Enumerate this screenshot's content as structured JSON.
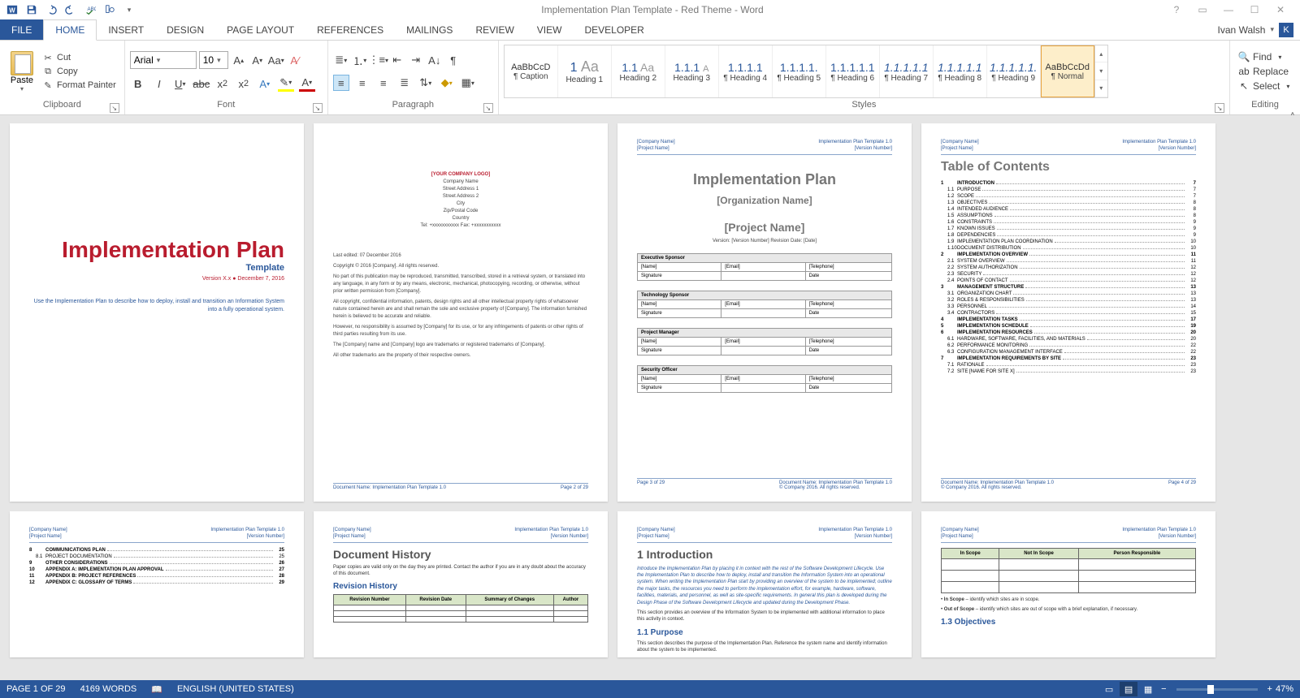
{
  "app": {
    "title": "Implementation Plan Template - Red Theme - Word",
    "user": "Ivan Walsh",
    "user_initial": "K"
  },
  "qat": {
    "save": "Save",
    "undo": "Undo",
    "redo": "Redo",
    "spell": "Spelling",
    "touch": "Touch/Mouse Mode"
  },
  "tabs": {
    "file": "FILE",
    "home": "HOME",
    "insert": "INSERT",
    "design": "DESIGN",
    "page_layout": "PAGE LAYOUT",
    "references": "REFERENCES",
    "mailings": "MAILINGS",
    "review": "REVIEW",
    "view": "VIEW",
    "developer": "DEVELOPER"
  },
  "ribbon": {
    "clipboard": {
      "label": "Clipboard",
      "paste": "Paste",
      "cut": "Cut",
      "copy": "Copy",
      "painter": "Format Painter"
    },
    "font": {
      "label": "Font",
      "name": "Arial",
      "size": "10"
    },
    "paragraph": {
      "label": "Paragraph"
    },
    "styles": {
      "label": "Styles",
      "items": [
        {
          "preview": "AaBbCcD",
          "name": "¶ Caption"
        },
        {
          "preview": "1",
          "name": "Heading 1"
        },
        {
          "preview": "1.1",
          "name": "Heading 2"
        },
        {
          "preview": "1.1.1",
          "name": "Heading 3"
        },
        {
          "preview": "1.1.1.1",
          "name": "¶ Heading 4"
        },
        {
          "preview": "1.1.1.1.",
          "name": "¶ Heading 5"
        },
        {
          "preview": "1.1.1.1.1",
          "name": "¶ Heading 6"
        },
        {
          "preview": "1.1.1.1.1",
          "name": "¶ Heading 7"
        },
        {
          "preview": "1.1.1.1.1",
          "name": "¶ Heading 8"
        },
        {
          "preview": "1.1.1.1.1.",
          "name": "¶ Heading 9"
        },
        {
          "preview": "AaBbCcDd",
          "name": "¶ Normal"
        }
      ],
      "preview_aa": "Aa"
    },
    "editing": {
      "label": "Editing",
      "find": "Find",
      "replace": "Replace",
      "select": "Select"
    }
  },
  "doc": {
    "header_left1": "[Company Name]",
    "header_left2": "[Project Name]",
    "header_right1": "Implementation Plan Template 1.0",
    "header_right2": "[Version Number]",
    "footer_doc": "Document Name: Implementation Plan Template 1.0",
    "footer_copy": "© Company 2016. All rights reserved.",
    "page1": {
      "title": "Implementation Plan",
      "subtitle": "Template",
      "version": "Version X.x ● December 7, 2016",
      "desc": "Use the Implementation Plan to describe how to deploy, install and transition an Information System into a fully operational system."
    },
    "page2": {
      "logo": "[YOUR COMPANY LOGO]",
      "lines": [
        "Company Name",
        "Street Address 1",
        "Street Address 2",
        "City",
        "Zip/Postal Code",
        "Country",
        "Tel: +xxxxxxxxxxx  Fax: +xxxxxxxxxxx"
      ],
      "edited": "Last edited: 07 December 2016",
      "copyright": "Copyright © 2016 [Company]. All rights reserved.",
      "body": [
        "No part of this publication may be reproduced, transmitted, transcribed, stored in a retrieval system, or translated into any language, in any form or by any means, electronic, mechanical, photocopying, recording, or otherwise, without prior written permission from [Company].",
        "All copyright, confidential information, patents, design rights and all other intellectual property rights of whatsoever nature contained herein are and shall remain the sole and exclusive property of [Company]. The information furnished herein is believed to be accurate and reliable.",
        "However, no responsibility is assumed by [Company] for its use, or for any infringements of patents or other rights of third parties resulting from its use.",
        "The [Company] name and [Company] logo are trademarks or registered trademarks of [Company].",
        "All other trademarks are the property of their respective owners."
      ],
      "pgno": "Page 2 of 29"
    },
    "page3": {
      "h1": "Implementation Plan",
      "h2": "[Organization Name]",
      "h3": "[Project Name]",
      "meta": "Version: [Version Number]          Revision Date: [Date]",
      "roles": [
        "Executive Sponsor",
        "Technology Sponsor",
        "Project Manager",
        "Security Officer"
      ],
      "cols": [
        "[Name]",
        "[Email]",
        "[Telephone]"
      ],
      "sig": "Signature",
      "date": "Date",
      "pgno": "Page 3 of 29"
    },
    "page4": {
      "title": "Table of Contents",
      "toc": [
        {
          "n": "1",
          "t": "INTRODUCTION",
          "p": "7",
          "l": 1
        },
        {
          "n": "1.1",
          "t": "PURPOSE",
          "p": "7",
          "l": 2
        },
        {
          "n": "1.2",
          "t": "SCOPE",
          "p": "7",
          "l": 2
        },
        {
          "n": "1.3",
          "t": "OBJECTIVES",
          "p": "8",
          "l": 2
        },
        {
          "n": "1.4",
          "t": "INTENDED AUDIENCE",
          "p": "8",
          "l": 2
        },
        {
          "n": "1.5",
          "t": "ASSUMPTIONS",
          "p": "8",
          "l": 2
        },
        {
          "n": "1.6",
          "t": "CONSTRAINTS",
          "p": "9",
          "l": 2
        },
        {
          "n": "1.7",
          "t": "KNOWN ISSUES",
          "p": "9",
          "l": 2
        },
        {
          "n": "1.8",
          "t": "DEPENDENCIES",
          "p": "9",
          "l": 2
        },
        {
          "n": "1.9",
          "t": "IMPLEMENTATION PLAN COORDINATION",
          "p": "10",
          "l": 2
        },
        {
          "n": "1.10",
          "t": "DOCUMENT DISTRIBUTION",
          "p": "10",
          "l": 2
        },
        {
          "n": "2",
          "t": "IMPLEMENTATION OVERVIEW",
          "p": "11",
          "l": 1
        },
        {
          "n": "2.1",
          "t": "SYSTEM OVERVIEW",
          "p": "11",
          "l": 2
        },
        {
          "n": "2.2",
          "t": "SYSTEM AUTHORIZATION",
          "p": "12",
          "l": 2
        },
        {
          "n": "2.3",
          "t": "SECURITY",
          "p": "12",
          "l": 2
        },
        {
          "n": "2.4",
          "t": "POINTS OF CONTACT",
          "p": "12",
          "l": 2
        },
        {
          "n": "3",
          "t": "MANAGEMENT STRUCTURE",
          "p": "13",
          "l": 1
        },
        {
          "n": "3.1",
          "t": "ORGANIZATION CHART",
          "p": "13",
          "l": 2
        },
        {
          "n": "3.2",
          "t": "ROLES & RESPONSIBILITIES",
          "p": "13",
          "l": 2
        },
        {
          "n": "3.3",
          "t": "PERSONNEL",
          "p": "14",
          "l": 2
        },
        {
          "n": "3.4",
          "t": "CONTRACTORS",
          "p": "15",
          "l": 2
        },
        {
          "n": "4",
          "t": "IMPLEMENTATION TASKS",
          "p": "17",
          "l": 1
        },
        {
          "n": "5",
          "t": "IMPLEMENTATION SCHEDULE",
          "p": "19",
          "l": 1
        },
        {
          "n": "6",
          "t": "IMPLEMENTATION RESOURCES",
          "p": "20",
          "l": 1
        },
        {
          "n": "6.1",
          "t": "HARDWARE, SOFTWARE, FACILITIES, AND MATERIALS",
          "p": "20",
          "l": 2
        },
        {
          "n": "6.2",
          "t": "PERFORMANCE MONITORING",
          "p": "22",
          "l": 2
        },
        {
          "n": "6.3",
          "t": "CONFIGURATION MANAGEMENT INTERFACE",
          "p": "22",
          "l": 2
        },
        {
          "n": "7",
          "t": "IMPLEMENTATION REQUIREMENTS BY SITE",
          "p": "23",
          "l": 1
        },
        {
          "n": "7.1",
          "t": "RATIONALE",
          "p": "23",
          "l": 2
        },
        {
          "n": "7.2",
          "t": "SITE [NAME FOR SITE X]",
          "p": "23",
          "l": 2
        }
      ],
      "pgno": "Page 4 of 29"
    },
    "page5": {
      "toc": [
        {
          "n": "8",
          "t": "COMMUNICATIONS PLAN",
          "p": "25",
          "l": 1
        },
        {
          "n": "8.1",
          "t": "PROJECT DOCUMENTATION",
          "p": "25",
          "l": 2
        },
        {
          "n": "9",
          "t": "OTHER CONSIDERATIONS",
          "p": "26",
          "l": 1
        },
        {
          "n": "10",
          "t": "APPENDIX A: IMPLEMENTATION PLAN APPROVAL",
          "p": "27",
          "l": 1
        },
        {
          "n": "11",
          "t": "APPENDIX B: PROJECT REFERENCES",
          "p": "28",
          "l": 1
        },
        {
          "n": "12",
          "t": "APPENDIX C: GLOSSARY OF TERMS",
          "p": "29",
          "l": 1
        }
      ]
    },
    "page6": {
      "h": "Document History",
      "note": "Paper copies are valid only on the day they are printed. Contact the author if you are in any doubt about the accuracy of this document.",
      "rh": "Revision History",
      "cols": [
        "Revision Number",
        "Revision Date",
        "Summary of Changes",
        "Author"
      ]
    },
    "page7": {
      "h": "1      Introduction",
      "intro": "Introduce the Implementation Plan by placing it in context with the rest of the Software Development Lifecycle. Use the Implementation Plan to describe how to deploy, install and transition the Information System into an operational system. When writing the Implementation Plan start by providing an overview of the system to be implemented; outline the major tasks, the resources you need to perform the implementation effort, for example, hardware, software, facilities, materials, and personnel, as well as site-specific requirements. In general this plan is developed during the Design Phase of the Software Development Lifecycle and updated during the Development Phase.",
      "body1": "This section provides an overview of the Information System to be implemented with additional information to place this activity in context.",
      "sub1": "1.1      Purpose",
      "body2": "This section describes the purpose of the Implementation Plan. Reference the system name and identify information about the system to be implemented."
    },
    "page8": {
      "cols": [
        "In Scope",
        "Not In Scope",
        "Person Responsible"
      ],
      "bul1": "In Scope – identify which sites are in scope.",
      "bul2": "Out of Scope – identify which sites are out of scope with a brief explanation, if necessary.",
      "obj": "1.3      Objectives"
    }
  },
  "status": {
    "page": "PAGE 1 OF 29",
    "words": "4169 WORDS",
    "lang": "ENGLISH (UNITED STATES)",
    "zoom": "47%",
    "minus": "−",
    "plus": "+"
  }
}
